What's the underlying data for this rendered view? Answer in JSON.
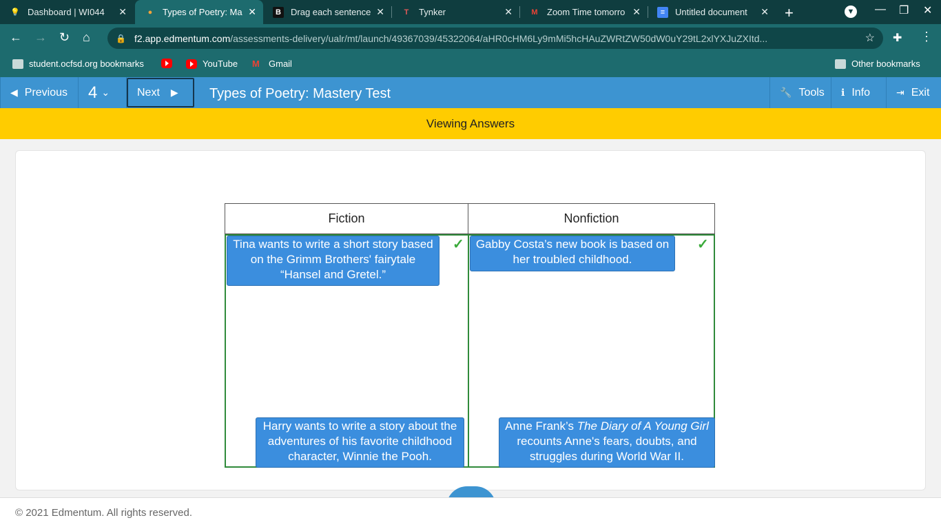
{
  "browser": {
    "tabs": [
      {
        "title": "Dashboard | WI044",
        "icon": "bulb-icon"
      },
      {
        "title": "Types of Poetry: Ma",
        "icon": "edmentum-icon"
      },
      {
        "title": "Drag each sentence",
        "icon": "brainly-icon"
      },
      {
        "title": "Tynker",
        "icon": "tynker-icon"
      },
      {
        "title": "Zoom Time tomorro",
        "icon": "gmail-icon"
      },
      {
        "title": "Untitled document",
        "icon": "docs-icon"
      }
    ],
    "url_host": "f2.app.edmentum.com",
    "url_path": "/assessments-delivery/ualr/mt/launch/49367039/45322064/aHR0cHM6Ly9mMi5hcHAuZWRtZW50dW0uY29tL2xlYXJuZXItd...",
    "bookmarks": [
      {
        "label": "student.ocfsd.org bookmarks"
      },
      {
        "label": ""
      },
      {
        "label": "YouTube"
      },
      {
        "label": "Gmail"
      }
    ],
    "other_bookmarks": "Other bookmarks"
  },
  "app": {
    "previous_label": "Previous",
    "question_number": "4",
    "next_label": "Next",
    "title": "Types of Poetry: Mastery Test",
    "tools_label": "Tools",
    "info_label": "Info",
    "exit_label": "Exit",
    "banner": "Viewing Answers"
  },
  "activity": {
    "fiction_header": "Fiction",
    "nonfiction_header": "Nonfiction",
    "fiction_items": [
      "Tina wants to write a short story based on the Grimm Brothers' fairytale “Hansel and Gretel.”",
      "Harry wants to write a story about the adventures of his favorite childhood character, Winnie the Pooh."
    ],
    "nonfiction_items": [
      "Gabby Costa’s new book is based on her troubled childhood.",
      "Anne Frank’s ",
      "The Diary of A Young Girl",
      " recounts Anne's fears, doubts, and struggles during World War II."
    ]
  },
  "footer": "© 2021 Edmentum. All rights reserved."
}
